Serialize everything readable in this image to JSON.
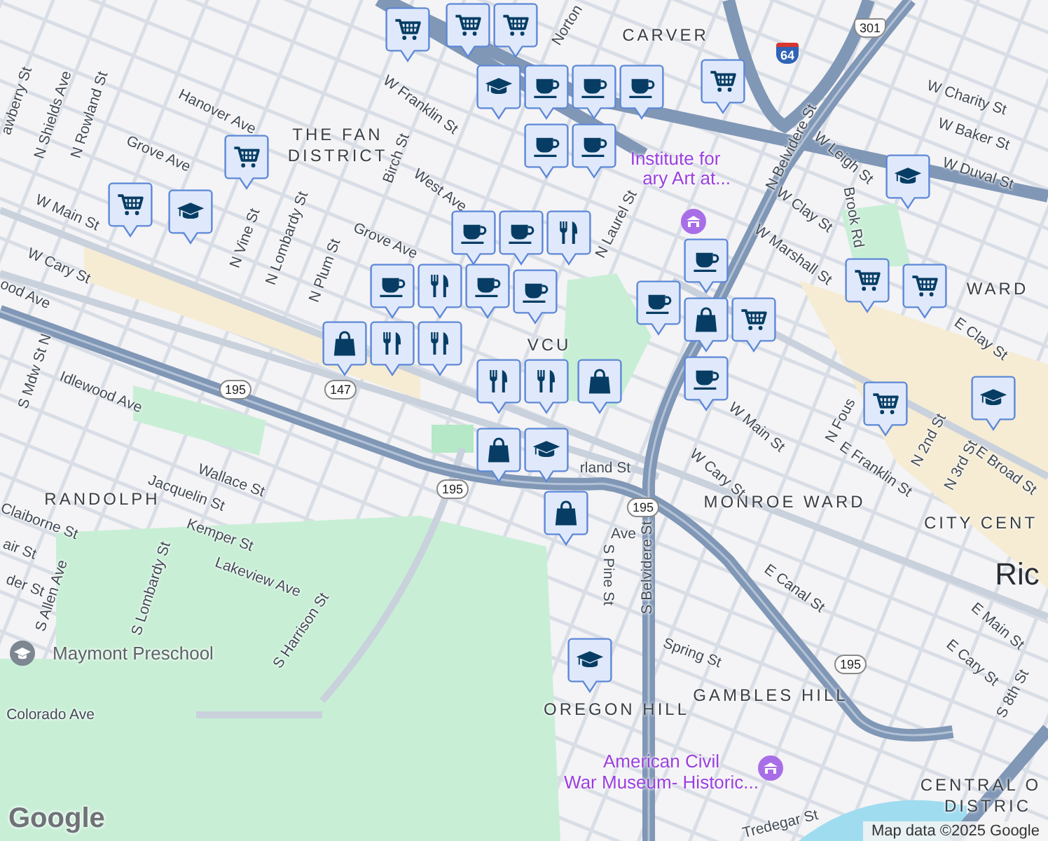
{
  "map": {
    "neighborhoods": [
      "CARVER",
      "THE FAN",
      "DISTRICT",
      "VCU",
      "WARD",
      "RANDOLPH",
      "MONROE WARD",
      "CITY CENT",
      "OREGON HILL",
      "GAMBLES HILL",
      "CENTRAL O",
      "DISTRIC"
    ],
    "city": "Ric",
    "streets": [
      "awberry St",
      "N Shields Ave",
      "N Rowland St",
      "Hanover Ave",
      "Grove Ave",
      "W Main St",
      "W Cary St",
      "ood Ave",
      "N Vine St",
      "N Lombardy St",
      "N Plum St",
      "Birch St",
      "W Franklin St",
      "West Ave",
      "Grove Ave",
      "Idlewood Ave",
      "S Mdw St N",
      "Norton",
      "N Belvidere St",
      "W Leigh St",
      "W Charity St",
      "W Baker St",
      "W Duval St",
      "W Clay St",
      "W Marshall St",
      "Brook Rd",
      "N Laurel St",
      "E Clay St",
      "W Main St",
      "W Cary St",
      "N Fous",
      "E Franklin St",
      "N 2nd St",
      "N 3rd St",
      "E Broad St",
      "rland St",
      "Ave",
      "S Pine St",
      "S Belvidere St",
      "E Canal St",
      "E Main St",
      "E Cary St",
      "S 8th St",
      "Spring St",
      "Tredegar St",
      "Wallace St",
      "Jacquelin St",
      "Kemper St",
      "Claiborne St",
      "Lakeview Ave",
      "air St",
      "der St",
      "S Allen Ave",
      "S Lombardy St",
      "S Harrison St",
      "Colorado Ave"
    ],
    "places": [
      {
        "kind": "museum",
        "lines": [
          "Institute for",
          "ary Art at..."
        ]
      },
      {
        "kind": "museum",
        "lines": [
          "American Civil",
          "War Museum- Historic..."
        ]
      },
      {
        "kind": "school",
        "lines": [
          "Maymont Preschool"
        ]
      }
    ],
    "route_shields": [
      {
        "kind": "state",
        "text": "195"
      },
      {
        "kind": "state",
        "text": "147"
      },
      {
        "kind": "state",
        "text": "195"
      },
      {
        "kind": "state",
        "text": "195"
      },
      {
        "kind": "state",
        "text": "195"
      },
      {
        "kind": "us",
        "text": "301"
      },
      {
        "kind": "interstate",
        "text": "64"
      }
    ],
    "pins": [
      {
        "kind": "cart"
      },
      {
        "kind": "cart"
      },
      {
        "kind": "cart"
      },
      {
        "kind": "school"
      },
      {
        "kind": "coffee"
      },
      {
        "kind": "coffee"
      },
      {
        "kind": "coffee"
      },
      {
        "kind": "coffee"
      },
      {
        "kind": "coffee"
      },
      {
        "kind": "cart"
      },
      {
        "kind": "cart"
      },
      {
        "kind": "school"
      },
      {
        "kind": "cart"
      },
      {
        "kind": "school"
      },
      {
        "kind": "coffee"
      },
      {
        "kind": "coffee"
      },
      {
        "kind": "food"
      },
      {
        "kind": "coffee"
      },
      {
        "kind": "bag"
      },
      {
        "kind": "cart"
      },
      {
        "kind": "coffee"
      },
      {
        "kind": "coffee"
      },
      {
        "kind": "cart"
      },
      {
        "kind": "cart"
      },
      {
        "kind": "coffee"
      },
      {
        "kind": "coffee"
      },
      {
        "kind": "food"
      },
      {
        "kind": "food"
      },
      {
        "kind": "coffee"
      },
      {
        "kind": "bag"
      },
      {
        "kind": "food"
      },
      {
        "kind": "food"
      },
      {
        "kind": "food"
      },
      {
        "kind": "bag"
      },
      {
        "kind": "cart"
      },
      {
        "kind": "school"
      },
      {
        "kind": "bag"
      },
      {
        "kind": "school"
      },
      {
        "kind": "bag"
      },
      {
        "kind": "school"
      }
    ]
  },
  "attribution": {
    "logo": "Google",
    "text": "Map data ©2025 Google"
  }
}
